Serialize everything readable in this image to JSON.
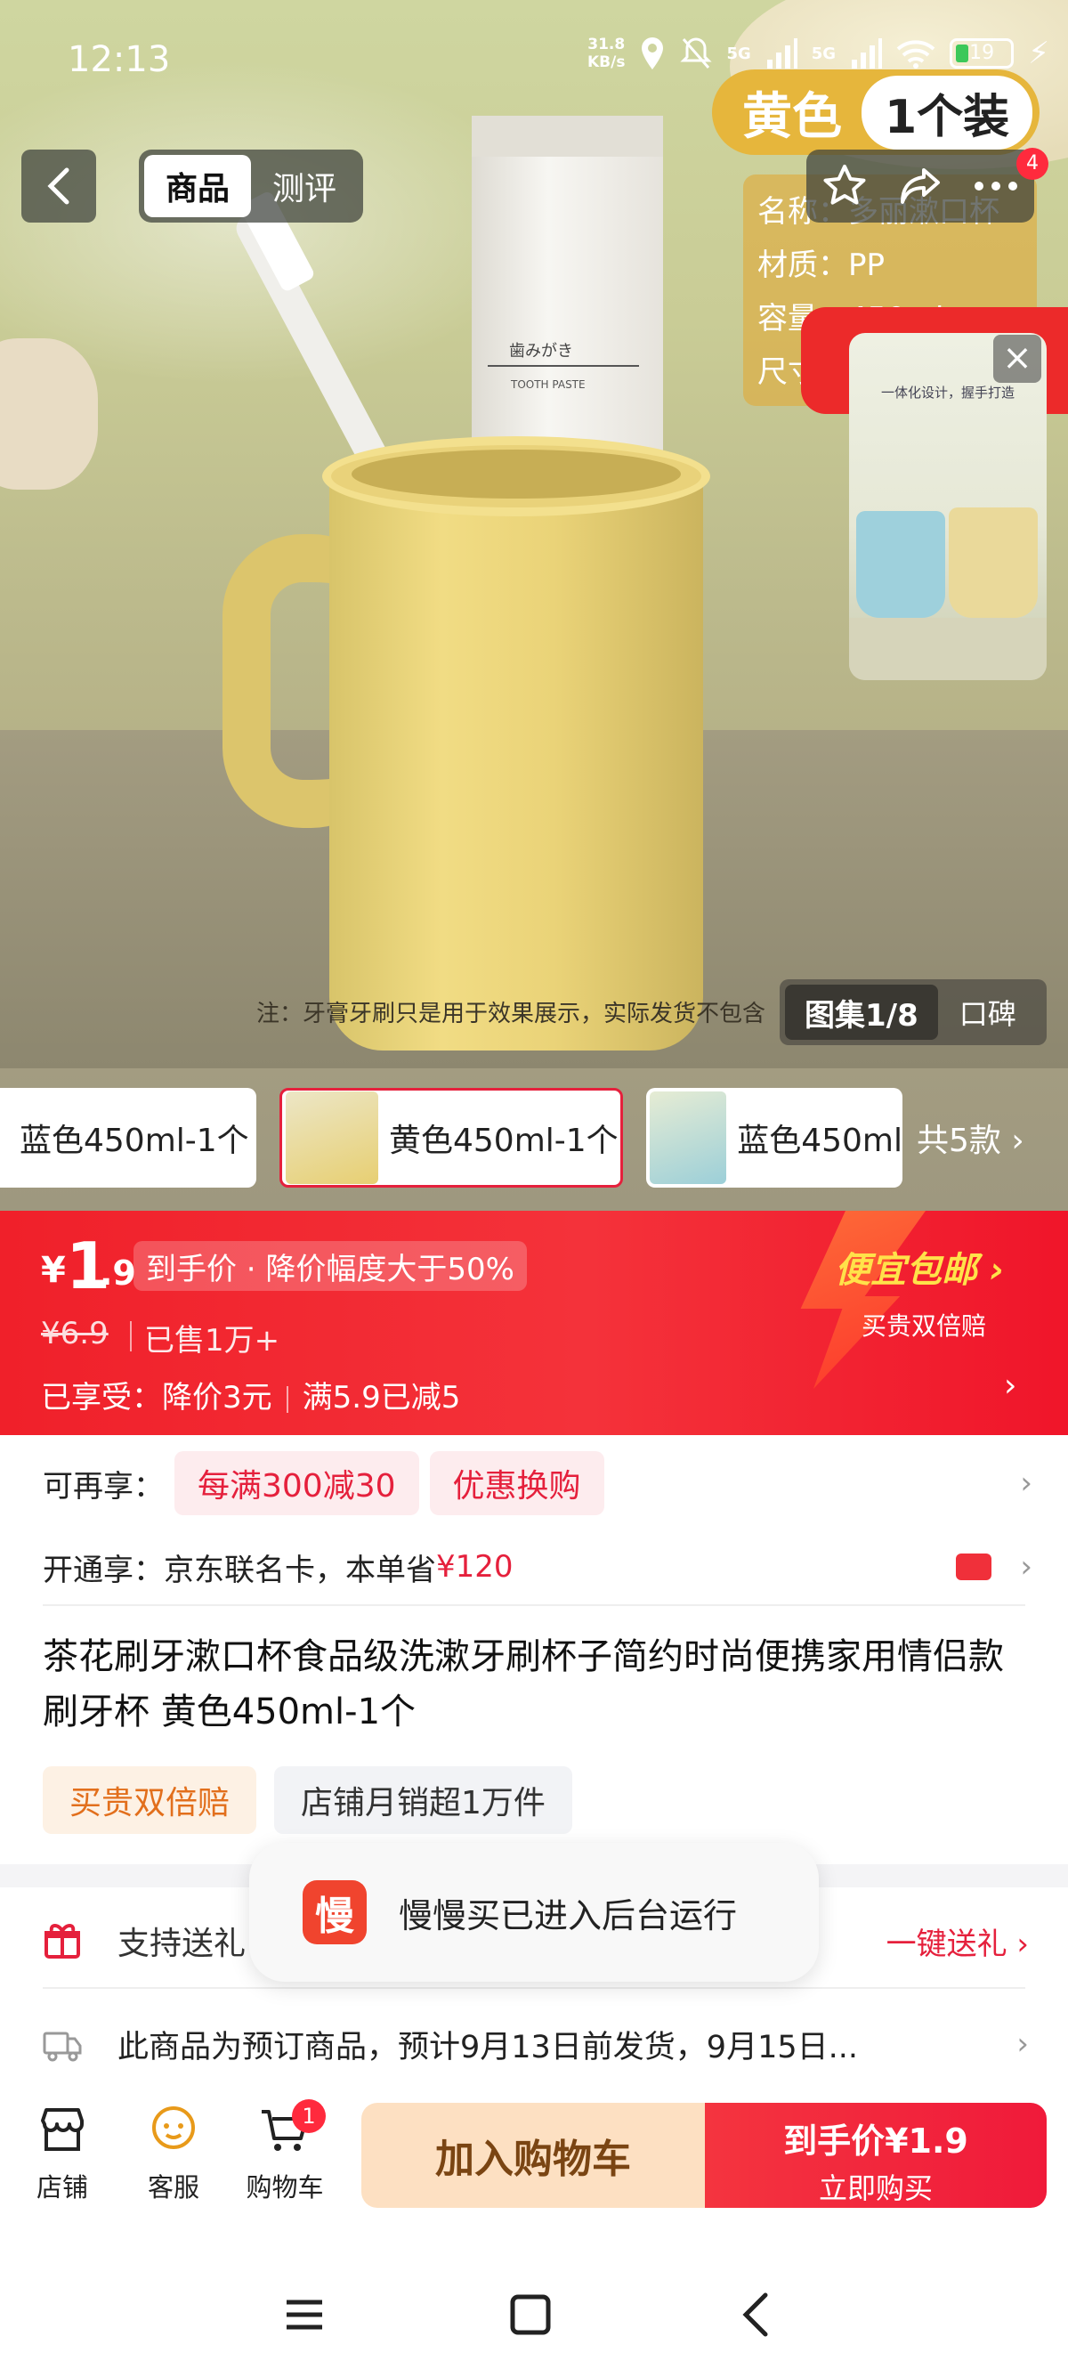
{
  "status_bar": {
    "time": "12:13",
    "net_speed_value": "31.8",
    "net_speed_unit": "KB/s",
    "network_1": "5G",
    "network_2": "5G",
    "battery": "19"
  },
  "header": {
    "tabs": [
      {
        "label": "商品",
        "active": true
      },
      {
        "label": "测评",
        "active": false
      }
    ],
    "more_badge": "4"
  },
  "hero": {
    "sticker_color": "黄色",
    "sticker_count": "1个装",
    "spec_lines": [
      "名称：多丽漱口杯",
      "材质：PP",
      "容量：450ml",
      "尺寸："
    ],
    "tube_text_1": "歯みがき",
    "tube_text_2": "TOOTH PASTE",
    "note": "注：牙膏牙刷只是用于效果展示，实际发货不包含",
    "float_video_title": "一体化设计，握手打造",
    "gallery_label": "图集1/8",
    "gallery_alt": "口碑"
  },
  "variants": {
    "items": [
      {
        "label": "蓝色450ml-1个",
        "selected": false
      },
      {
        "label": "黄色450ml-1个",
        "selected": true
      },
      {
        "label": "蓝色450ml",
        "selected": false
      }
    ],
    "total": "共5款"
  },
  "price": {
    "currency": "¥",
    "integer": "1",
    "decimal": ".9",
    "tag": "到手价 · 降价幅度大于50%",
    "original": "¥6.9",
    "sold": "已售1万+",
    "enjoy_prefix": "已享受：",
    "enjoy_1": "降价3元",
    "enjoy_2": "满5.9已减5",
    "free_ship": "便宜包邮",
    "free_ship_sub": "买贵双倍赔"
  },
  "promo": {
    "label": "可再享：",
    "chips": [
      "每满300减30",
      "优惠换购"
    ]
  },
  "card": {
    "label": "开通享：",
    "text": "京东联名卡，本单省",
    "amount": "¥120"
  },
  "product": {
    "title": "茶花刷牙漱口杯食品级洗漱牙刷杯子简约时尚便携家用情侣款刷牙杯 黄色450ml-1个",
    "tags": [
      "买贵双倍赔",
      "店铺月销超1万件"
    ]
  },
  "gift": {
    "label": "支持送礼",
    "action": "一键送礼"
  },
  "shipping": {
    "text": "此商品为预订商品，预计9月13日前发货，9月15日..."
  },
  "toast": {
    "icon_char": "慢",
    "text": "慢慢买已进入后台运行"
  },
  "action_bar": {
    "store": "店铺",
    "service": "客服",
    "cart": "购物车",
    "cart_badge": "1",
    "add_to_cart": "加入购物车",
    "buy_line1": "到手价¥1.9",
    "buy_line2": "立即购买"
  },
  "colors": {
    "accent_red": "#e5203c",
    "price_banner": "#f0202a",
    "cart_button": "#fde0c2",
    "free_ship_yellow": "#ffe24a"
  }
}
